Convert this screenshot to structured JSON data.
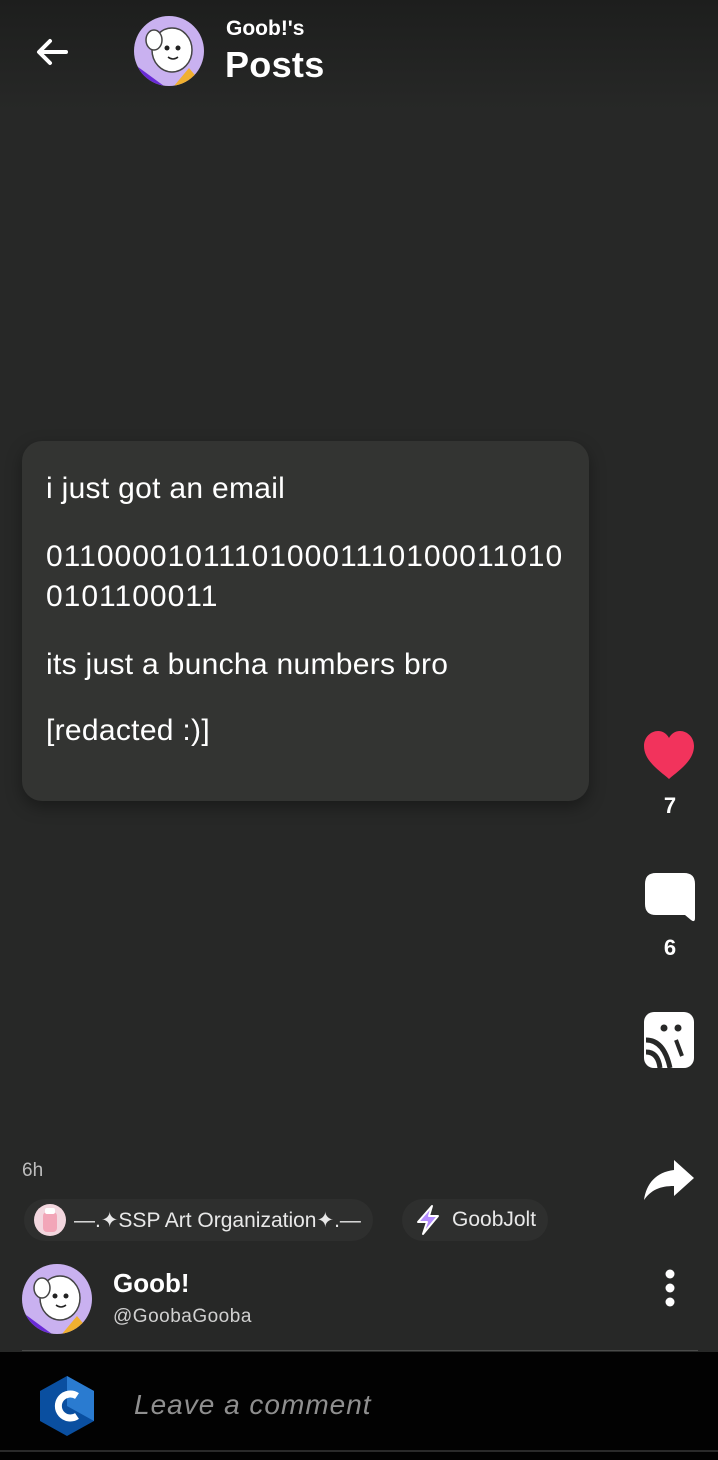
{
  "header": {
    "subtitle": "Goob!'s",
    "title": "Posts"
  },
  "post": {
    "lines": [
      "i just got an email",
      "0110000101110100011101000110100101100011",
      "its just a buncha numbers bro",
      "[redacted :)]"
    ],
    "likes": "7",
    "comments": "6",
    "time_ago": "6h",
    "chips": [
      {
        "label": "—.✦SSP Art Organization✦.—"
      },
      {
        "label": "GoobJolt"
      }
    ],
    "author": {
      "name": "Goob!",
      "handle": "@GoobaGooba"
    }
  },
  "comment_bar": {
    "placeholder": "Leave a comment"
  },
  "colors": {
    "background": "#272827",
    "card": "#333432",
    "like": "#f2335c",
    "comment_bar": "#020202"
  },
  "icons": [
    "back-arrow-icon",
    "heart-icon",
    "comment-bubble-icon",
    "stage-icon",
    "share-arrow-icon",
    "more-vertical-icon",
    "lightning-icon"
  ]
}
